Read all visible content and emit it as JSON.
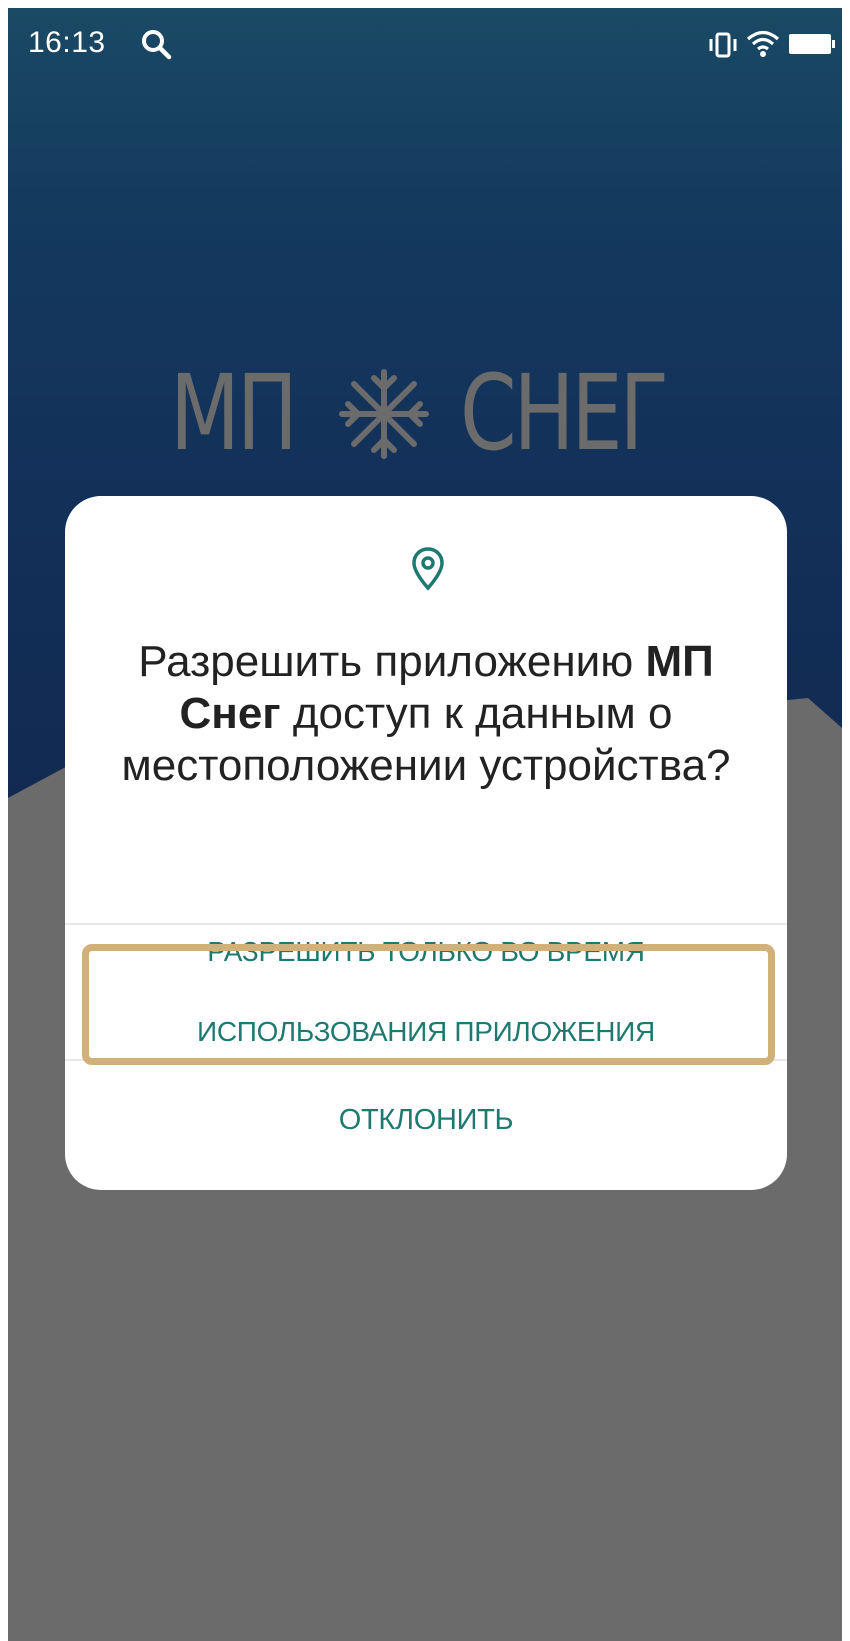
{
  "status_bar": {
    "time": "16:13",
    "icons": [
      "search-icon",
      "vibrate-icon",
      "wifi-icon",
      "battery-icon"
    ]
  },
  "app_logo": {
    "left_text": "МП",
    "right_text": "СНЕГ",
    "emblem": "snowflake-icon",
    "color": "#6b6b6b"
  },
  "dialog": {
    "icon": "location-pin-icon",
    "title_prefix": "Разрешить приложению ",
    "app_name": "МП Снег",
    "title_suffix": " доступ к данным о местоположении устройства?",
    "allow_line_1": "РАЗРЕШИТЬ ТОЛЬКО ВО ВРЕМЯ",
    "allow_line_2": "ИСПОЛЬЗОВАНИЯ ПРИЛОЖЕНИЯ",
    "deny_label": "ОТКЛОНИТЬ",
    "button_color": "#1e7a70"
  },
  "colors": {
    "background_top": "#1a4a64",
    "background_bottom": "#12284d",
    "mountain": "#6b6b6b",
    "highlight": "#d1b179"
  }
}
